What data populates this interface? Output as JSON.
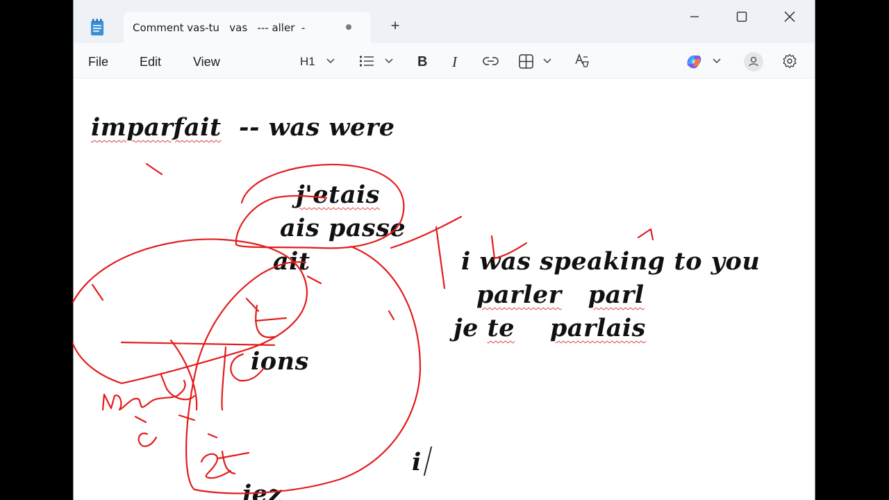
{
  "window": {
    "tab_title": "Comment vas-tu   vas   --- aller  -",
    "new_tab_icon": "plus-icon",
    "controls": [
      "minimize-icon",
      "maximize-icon",
      "close-icon"
    ]
  },
  "menu": {
    "file": "File",
    "edit": "Edit",
    "view": "View"
  },
  "toolbar": {
    "heading": "H1",
    "list_icon": "bulleted-list-icon",
    "bold": "B",
    "italic": "I",
    "link_icon": "link-icon",
    "table_icon": "table-icon",
    "clear_format_icon": "clear-formatting-icon",
    "copilot_icon": "copilot-icon",
    "account_icon": "account-icon",
    "settings_icon": "gear-icon"
  },
  "document": {
    "line1_a": "imparfait",
    "line1_b": "  -- was were",
    "line2": "j'etais",
    "line3": "ais passe",
    "line4": "ait",
    "line5": "i was speaking to you",
    "line6_a": "parler",
    "line6_b": "parl",
    "line7_a": "je",
    "line7_b": "te",
    "line7_c": "parlais",
    "line8": "ions",
    "line9": "i",
    "line10": "iez"
  },
  "colors": {
    "ink": "#e31b1b",
    "spell_underline": "#e03a3a",
    "text": "#111111"
  }
}
